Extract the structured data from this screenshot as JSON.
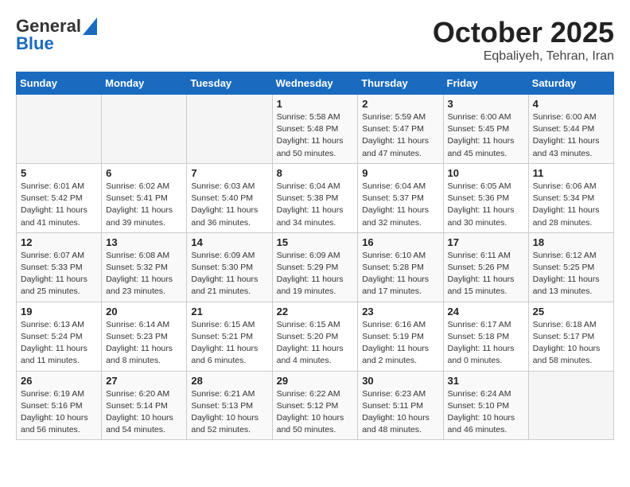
{
  "header": {
    "logo_line1": "General",
    "logo_line2": "Blue",
    "month": "October 2025",
    "location": "Eqbaliyeh, Tehran, Iran"
  },
  "days_of_week": [
    "Sunday",
    "Monday",
    "Tuesday",
    "Wednesday",
    "Thursday",
    "Friday",
    "Saturday"
  ],
  "weeks": [
    [
      {
        "day": "",
        "info": ""
      },
      {
        "day": "",
        "info": ""
      },
      {
        "day": "",
        "info": ""
      },
      {
        "day": "1",
        "info": "Sunrise: 5:58 AM\nSunset: 5:48 PM\nDaylight: 11 hours\nand 50 minutes."
      },
      {
        "day": "2",
        "info": "Sunrise: 5:59 AM\nSunset: 5:47 PM\nDaylight: 11 hours\nand 47 minutes."
      },
      {
        "day": "3",
        "info": "Sunrise: 6:00 AM\nSunset: 5:45 PM\nDaylight: 11 hours\nand 45 minutes."
      },
      {
        "day": "4",
        "info": "Sunrise: 6:00 AM\nSunset: 5:44 PM\nDaylight: 11 hours\nand 43 minutes."
      }
    ],
    [
      {
        "day": "5",
        "info": "Sunrise: 6:01 AM\nSunset: 5:42 PM\nDaylight: 11 hours\nand 41 minutes."
      },
      {
        "day": "6",
        "info": "Sunrise: 6:02 AM\nSunset: 5:41 PM\nDaylight: 11 hours\nand 39 minutes."
      },
      {
        "day": "7",
        "info": "Sunrise: 6:03 AM\nSunset: 5:40 PM\nDaylight: 11 hours\nand 36 minutes."
      },
      {
        "day": "8",
        "info": "Sunrise: 6:04 AM\nSunset: 5:38 PM\nDaylight: 11 hours\nand 34 minutes."
      },
      {
        "day": "9",
        "info": "Sunrise: 6:04 AM\nSunset: 5:37 PM\nDaylight: 11 hours\nand 32 minutes."
      },
      {
        "day": "10",
        "info": "Sunrise: 6:05 AM\nSunset: 5:36 PM\nDaylight: 11 hours\nand 30 minutes."
      },
      {
        "day": "11",
        "info": "Sunrise: 6:06 AM\nSunset: 5:34 PM\nDaylight: 11 hours\nand 28 minutes."
      }
    ],
    [
      {
        "day": "12",
        "info": "Sunrise: 6:07 AM\nSunset: 5:33 PM\nDaylight: 11 hours\nand 25 minutes."
      },
      {
        "day": "13",
        "info": "Sunrise: 6:08 AM\nSunset: 5:32 PM\nDaylight: 11 hours\nand 23 minutes."
      },
      {
        "day": "14",
        "info": "Sunrise: 6:09 AM\nSunset: 5:30 PM\nDaylight: 11 hours\nand 21 minutes."
      },
      {
        "day": "15",
        "info": "Sunrise: 6:09 AM\nSunset: 5:29 PM\nDaylight: 11 hours\nand 19 minutes."
      },
      {
        "day": "16",
        "info": "Sunrise: 6:10 AM\nSunset: 5:28 PM\nDaylight: 11 hours\nand 17 minutes."
      },
      {
        "day": "17",
        "info": "Sunrise: 6:11 AM\nSunset: 5:26 PM\nDaylight: 11 hours\nand 15 minutes."
      },
      {
        "day": "18",
        "info": "Sunrise: 6:12 AM\nSunset: 5:25 PM\nDaylight: 11 hours\nand 13 minutes."
      }
    ],
    [
      {
        "day": "19",
        "info": "Sunrise: 6:13 AM\nSunset: 5:24 PM\nDaylight: 11 hours\nand 11 minutes."
      },
      {
        "day": "20",
        "info": "Sunrise: 6:14 AM\nSunset: 5:23 PM\nDaylight: 11 hours\nand 8 minutes."
      },
      {
        "day": "21",
        "info": "Sunrise: 6:15 AM\nSunset: 5:21 PM\nDaylight: 11 hours\nand 6 minutes."
      },
      {
        "day": "22",
        "info": "Sunrise: 6:15 AM\nSunset: 5:20 PM\nDaylight: 11 hours\nand 4 minutes."
      },
      {
        "day": "23",
        "info": "Sunrise: 6:16 AM\nSunset: 5:19 PM\nDaylight: 11 hours\nand 2 minutes."
      },
      {
        "day": "24",
        "info": "Sunrise: 6:17 AM\nSunset: 5:18 PM\nDaylight: 11 hours\nand 0 minutes."
      },
      {
        "day": "25",
        "info": "Sunrise: 6:18 AM\nSunset: 5:17 PM\nDaylight: 10 hours\nand 58 minutes."
      }
    ],
    [
      {
        "day": "26",
        "info": "Sunrise: 6:19 AM\nSunset: 5:16 PM\nDaylight: 10 hours\nand 56 minutes."
      },
      {
        "day": "27",
        "info": "Sunrise: 6:20 AM\nSunset: 5:14 PM\nDaylight: 10 hours\nand 54 minutes."
      },
      {
        "day": "28",
        "info": "Sunrise: 6:21 AM\nSunset: 5:13 PM\nDaylight: 10 hours\nand 52 minutes."
      },
      {
        "day": "29",
        "info": "Sunrise: 6:22 AM\nSunset: 5:12 PM\nDaylight: 10 hours\nand 50 minutes."
      },
      {
        "day": "30",
        "info": "Sunrise: 6:23 AM\nSunset: 5:11 PM\nDaylight: 10 hours\nand 48 minutes."
      },
      {
        "day": "31",
        "info": "Sunrise: 6:24 AM\nSunset: 5:10 PM\nDaylight: 10 hours\nand 46 minutes."
      },
      {
        "day": "",
        "info": ""
      }
    ]
  ]
}
